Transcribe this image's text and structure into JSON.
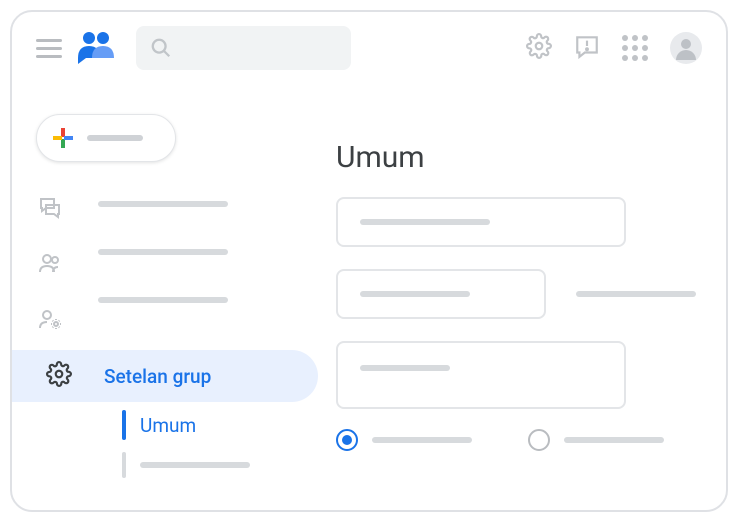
{
  "header": {
    "search_placeholder": ""
  },
  "sidebar": {
    "selected_label": "Setelan grup",
    "sub_selected_label": "Umum"
  },
  "main": {
    "title": "Umum"
  }
}
